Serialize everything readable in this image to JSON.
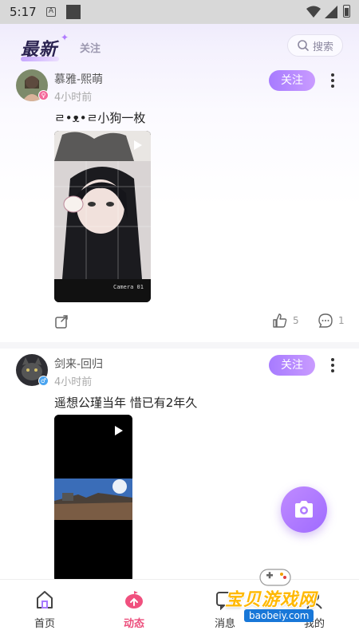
{
  "status_bar": {
    "time": "5:17",
    "a_icon": "A"
  },
  "header": {
    "tab_latest": "最新",
    "tab_follow": "关注",
    "search_label": "搜索"
  },
  "posts": [
    {
      "username": "慕雅-熙萌",
      "time": "4小时前",
      "text": "ㄹ•ᴥ•ㄹ小狗一枚",
      "follow_label": "关注",
      "likes": "5",
      "comments": "1",
      "media_caption": "Camera 01"
    },
    {
      "username": "剑来-回归",
      "time": "4小时前",
      "text": "遥想公瑾当年 惜已有2年久",
      "follow_label": "关注"
    }
  ],
  "bottom_nav": {
    "items": [
      {
        "label": "首页",
        "icon": "home-icon"
      },
      {
        "label": "动态",
        "icon": "feed-icon"
      },
      {
        "label": "消息",
        "icon": "message-icon"
      },
      {
        "label": "我的",
        "icon": "profile-icon"
      }
    ]
  },
  "watermark": {
    "cn": "宝贝游戏网",
    "url": "baobeiy.com"
  },
  "colors": {
    "accent": "#a77bff",
    "nav_active": "#ec4e7c"
  }
}
